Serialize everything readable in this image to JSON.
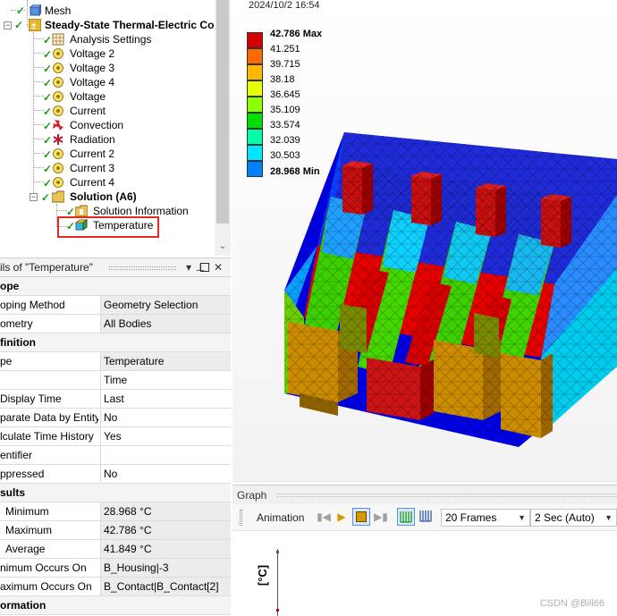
{
  "tree": {
    "items": [
      {
        "label": "Mesh",
        "icon": "mesh-icon"
      },
      {
        "label": "Steady-State Thermal-Electric Co",
        "icon": "analysis-icon"
      },
      {
        "label": "Analysis Settings",
        "icon": "settings-icon"
      },
      {
        "label": "Voltage 2",
        "icon": "voltage-icon"
      },
      {
        "label": "Voltage 3",
        "icon": "voltage-icon"
      },
      {
        "label": "Voltage 4",
        "icon": "voltage-icon"
      },
      {
        "label": "Voltage",
        "icon": "voltage-icon"
      },
      {
        "label": "Current",
        "icon": "current-icon"
      },
      {
        "label": "Convection",
        "icon": "convection-icon"
      },
      {
        "label": "Radiation",
        "icon": "radiation-icon"
      },
      {
        "label": "Current 2",
        "icon": "current-icon"
      },
      {
        "label": "Current 3",
        "icon": "current-icon"
      },
      {
        "label": "Current 4",
        "icon": "current-icon"
      },
      {
        "label": "Solution (A6)",
        "icon": "solution-icon"
      },
      {
        "label": "Solution Information",
        "icon": "solution-info-icon"
      },
      {
        "label": "Temperature",
        "icon": "temperature-icon"
      }
    ]
  },
  "details": {
    "title": "ils of \"Temperature\"",
    "rows": [
      {
        "type": "section",
        "label": "ope"
      },
      {
        "label": "oping Method",
        "value": "Geometry Selection"
      },
      {
        "label": "ometry",
        "value": "All Bodies"
      },
      {
        "type": "section",
        "label": "finition"
      },
      {
        "label": "pe",
        "value": "Temperature"
      },
      {
        "label": "",
        "value": "Time"
      },
      {
        "label": "Display Time",
        "value": "Last"
      },
      {
        "label": "parate Data by Entity",
        "value": "No"
      },
      {
        "label": "lculate Time History",
        "value": "Yes"
      },
      {
        "label": "entifier",
        "value": ""
      },
      {
        "label": "ppressed",
        "value": "No"
      },
      {
        "type": "section",
        "label": "sults"
      },
      {
        "label": "Minimum",
        "value": "28.968 °C"
      },
      {
        "label": "Maximum",
        "value": "42.786 °C"
      },
      {
        "label": "Average",
        "value": "41.849 °C"
      },
      {
        "label": "nimum Occurs On",
        "value": "B_Housing|-3"
      },
      {
        "label": "aximum Occurs On",
        "value": "B_Contact|B_Contact[2]"
      },
      {
        "type": "section",
        "label": "ormation"
      }
    ]
  },
  "viewport": {
    "timestamp": "2024/10/2 16:54",
    "legend": [
      {
        "value": "42.786 Max",
        "color": "#d40000",
        "bold": true
      },
      {
        "value": "41.251",
        "color": "#ff6a00"
      },
      {
        "value": "39.715",
        "color": "#ffb700"
      },
      {
        "value": "38.18",
        "color": "#e6ff00"
      },
      {
        "value": "36.645",
        "color": "#8cff00"
      },
      {
        "value": "35.109",
        "color": "#00e000"
      },
      {
        "value": "33.574",
        "color": "#00ffa8"
      },
      {
        "value": "32.039",
        "color": "#00e6ff"
      },
      {
        "value": "30.503",
        "color": "#0080ff"
      },
      {
        "value": "28.968 Min",
        "color": "#0000ff",
        "bold": true
      }
    ]
  },
  "graph": {
    "title": "Graph",
    "animation_label": "Animation",
    "frames": "20 Frames",
    "duration": "2 Sec (Auto)",
    "ylabel": "[°C]",
    "watermark": "CSDN @Bill66"
  }
}
